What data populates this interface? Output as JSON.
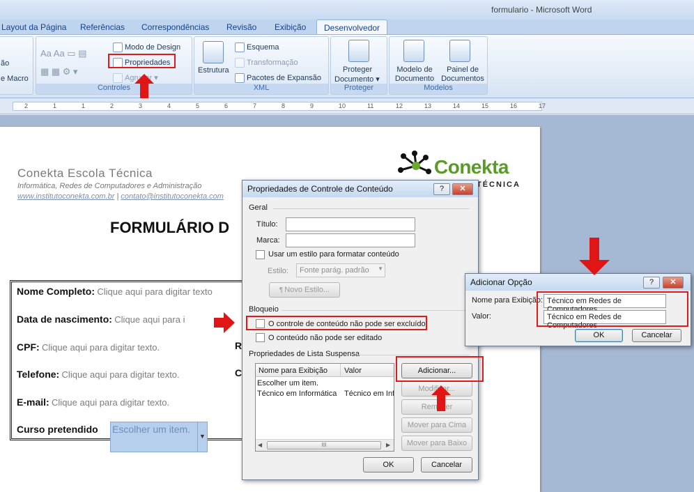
{
  "window": {
    "title": "formulario - Microsoft Word"
  },
  "tabs": [
    "Layout da Página",
    "Referências",
    "Correspondências",
    "Revisão",
    "Exibição",
    "Desenvolvedor"
  ],
  "ribbon": {
    "left_fragments": [
      "ão",
      "e Macro"
    ],
    "controls": {
      "modo_design": "Modo de Design",
      "propriedades": "Propriedades",
      "agrupar": "Agrupar",
      "group_label": "Controles"
    },
    "xml": {
      "estrutura": "Estrutura",
      "esquema": "Esquema",
      "transformacao": "Transformação",
      "pacotes": "Pacotes de Expansão",
      "group_label": "XML"
    },
    "proteger": {
      "button": "Proteger Documento",
      "arrow": "▾",
      "group_label": "Proteger"
    },
    "modelos": {
      "modelo": "Modelo de Documento",
      "painel": "Painel de Documentos",
      "group_label": "Modelos"
    }
  },
  "ruler": {
    "numbers": [
      "2",
      "1",
      "1",
      "2",
      "3",
      "4",
      "5",
      "6",
      "7",
      "8",
      "9",
      "10",
      "11",
      "12",
      "13",
      "14",
      "15",
      "16",
      "17"
    ]
  },
  "document": {
    "header_title": "Conekta Escola Técnica",
    "header_sub": "Informática, Redes de Computadores e Administração",
    "header_link1": "www.institutoconekta.com.br",
    "header_link2": "contato@institutoconekta.com",
    "logo_text": "Conekta",
    "logo_sub": "TÉCNICA",
    "form_title": "FORMULÁRIO D",
    "fields": [
      {
        "label": "Nome Completo:",
        "placeholder": "Clique aqui para digitar texto"
      },
      {
        "label": "Data de nascimento:",
        "placeholder": "Clique aqui para i"
      },
      {
        "label": "CPF:",
        "placeholder": "Clique aqui para digitar texto."
      },
      {
        "label": "Telefone:",
        "placeholder": "Clique aqui para digitar texto."
      },
      {
        "label": "E-mail:",
        "placeholder": "Clique aqui para digitar texto."
      },
      {
        "label": "Curso pretendido",
        "placeholder": "Escolher um item."
      }
    ],
    "right_fragments": [
      "R",
      "C"
    ]
  },
  "dialog_props": {
    "title": "Propriedades de Controle de Conteúdo",
    "help": "?",
    "close": "✕",
    "geral": "Geral",
    "titulo_label": "Título:",
    "marca_label": "Marca:",
    "usar_estilo": "Usar um estilo para formatar conteúdo",
    "estilo_label": "Estilo:",
    "estilo_value": "Fonte parág. padrão",
    "novo_estilo": "Novo Estilo...",
    "bloqueio": "Bloqueio",
    "nao_excluido": "O controle de conteúdo não pode ser excluído",
    "nao_editado": "O conteúdo não pode ser editado",
    "lista_label": "Propriedades de Lista Suspensa",
    "col_nome": "Nome para Exibição",
    "col_valor": "Valor",
    "rows": [
      {
        "nome": "Escolher um item.",
        "valor": ""
      },
      {
        "nome": "Técnico em Informática",
        "valor": "Técnico em Inf"
      }
    ],
    "scroll_mid": "III",
    "adicionar": "Adicionar...",
    "modificar": "Modificar...",
    "remover": "Remover",
    "mover_cima": "Mover para Cima",
    "mover_baixo": "Mover para Baixo",
    "ok": "OK",
    "cancelar": "Cancelar"
  },
  "dialog_add": {
    "title": "Adicionar Opção",
    "help": "?",
    "close": "✕",
    "nome_label": "Nome para Exibição:",
    "nome_value": "Técnico em Redes de Computadores",
    "valor_label": "Valor:",
    "valor_value": "Técnico em Redes de Computadores",
    "ok": "OK",
    "cancelar": "Cancelar"
  },
  "colors": {
    "highlight": "#e0191b",
    "ribbon_text": "#15428b",
    "logo_green": "#6aab2e"
  }
}
